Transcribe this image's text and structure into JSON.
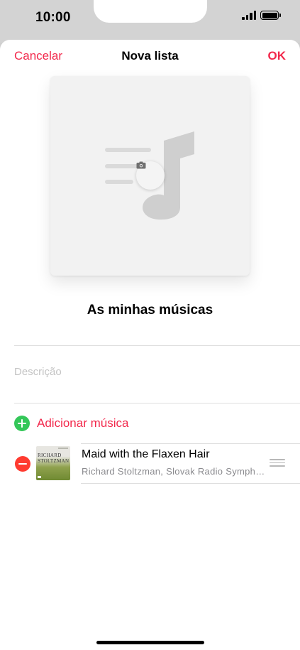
{
  "status_bar": {
    "time": "10:00"
  },
  "nav": {
    "cancel_label": "Cancelar",
    "title": "Nova lista",
    "done_label": "OK"
  },
  "artwork": {
    "icons": [
      "music-note-icon",
      "camera-icon"
    ]
  },
  "playlist": {
    "name": "As minhas músicas",
    "description_placeholder": "Descrição"
  },
  "add_music_label": "Adicionar música",
  "songs": [
    {
      "title": "Maid with the Flaxen Hair",
      "artist": "Richard Stoltzman, Slovak Radio Symphony Orchestra",
      "album_art_text_line1": "RICHARD",
      "album_art_text_line2": "STOLTZMAN"
    }
  ],
  "colors": {
    "accent": "#f2294c",
    "add": "#34c759",
    "remove": "#ff3b30"
  }
}
